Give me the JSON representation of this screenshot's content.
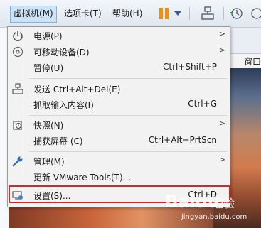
{
  "menubar": {
    "items": [
      {
        "label": "虚拟机(M)",
        "active": true
      },
      {
        "label": "选项卡(T)",
        "active": false
      },
      {
        "label": "帮助(H)",
        "active": false
      }
    ]
  },
  "background": {
    "panel_label": "窗口"
  },
  "menu": {
    "items": [
      {
        "label": "电源(P)",
        "shortcut": "",
        "submenu": true,
        "icon": "power-icon"
      },
      {
        "label": "可移动设备(D)",
        "shortcut": "",
        "submenu": true,
        "icon": "disc-icon"
      },
      {
        "label": "暂停(U)",
        "shortcut": "Ctrl+Shift+P",
        "submenu": false,
        "icon": ""
      },
      {
        "label": "发送 Ctrl+Alt+Del(E)",
        "shortcut": "",
        "submenu": false,
        "icon": "send-keys-icon"
      },
      {
        "label": "抓取输入内容(I)",
        "shortcut": "Ctrl+G",
        "submenu": false,
        "icon": ""
      },
      {
        "label": "快照(N)",
        "shortcut": "",
        "submenu": true,
        "icon": "snapshot-icon"
      },
      {
        "label": "捕获屏幕 (C)",
        "shortcut": "Ctrl+Alt+PrtScn",
        "submenu": false,
        "icon": ""
      },
      {
        "label": "管理(M)",
        "shortcut": "",
        "submenu": true,
        "icon": "wrench-icon"
      },
      {
        "label": "更新 VMware Tools(T)...",
        "shortcut": "",
        "submenu": false,
        "icon": ""
      },
      {
        "label": "设置(S)...",
        "shortcut": "Ctrl+D",
        "submenu": false,
        "icon": "settings-icon"
      }
    ]
  },
  "watermark": {
    "text": "jingyan.baidu.com"
  },
  "colors": {
    "highlight": "#d9252a",
    "pause": "#e8901c",
    "menu_bg": "#f2f2f2"
  }
}
